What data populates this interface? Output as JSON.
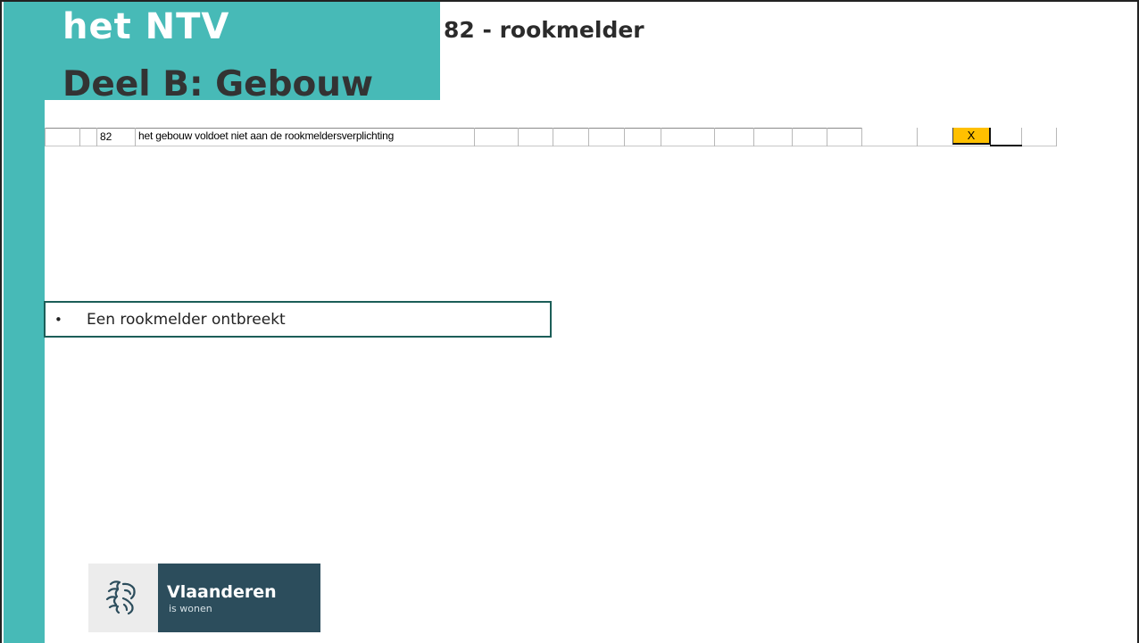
{
  "slide": {
    "title_line1": "het NTV",
    "title_line2": "Deel B: Gebouw",
    "item_heading": "82 - rookmelder"
  },
  "table": {
    "row": {
      "number": "82",
      "description": "het gebouw voldoet niet aan de rookmeldersverplichting",
      "mark": "X"
    }
  },
  "note": {
    "bullet": "•",
    "text": "Een rookmelder ontbreekt"
  },
  "logo": {
    "name": "Vlaanderen",
    "subtitle": "is wonen",
    "icon": "lion-icon"
  },
  "colors": {
    "accent_teal": "#47bab7",
    "note_border": "#1c5e58",
    "mark_fill": "#ffc000",
    "logo_panel": "#2c4d5c"
  }
}
